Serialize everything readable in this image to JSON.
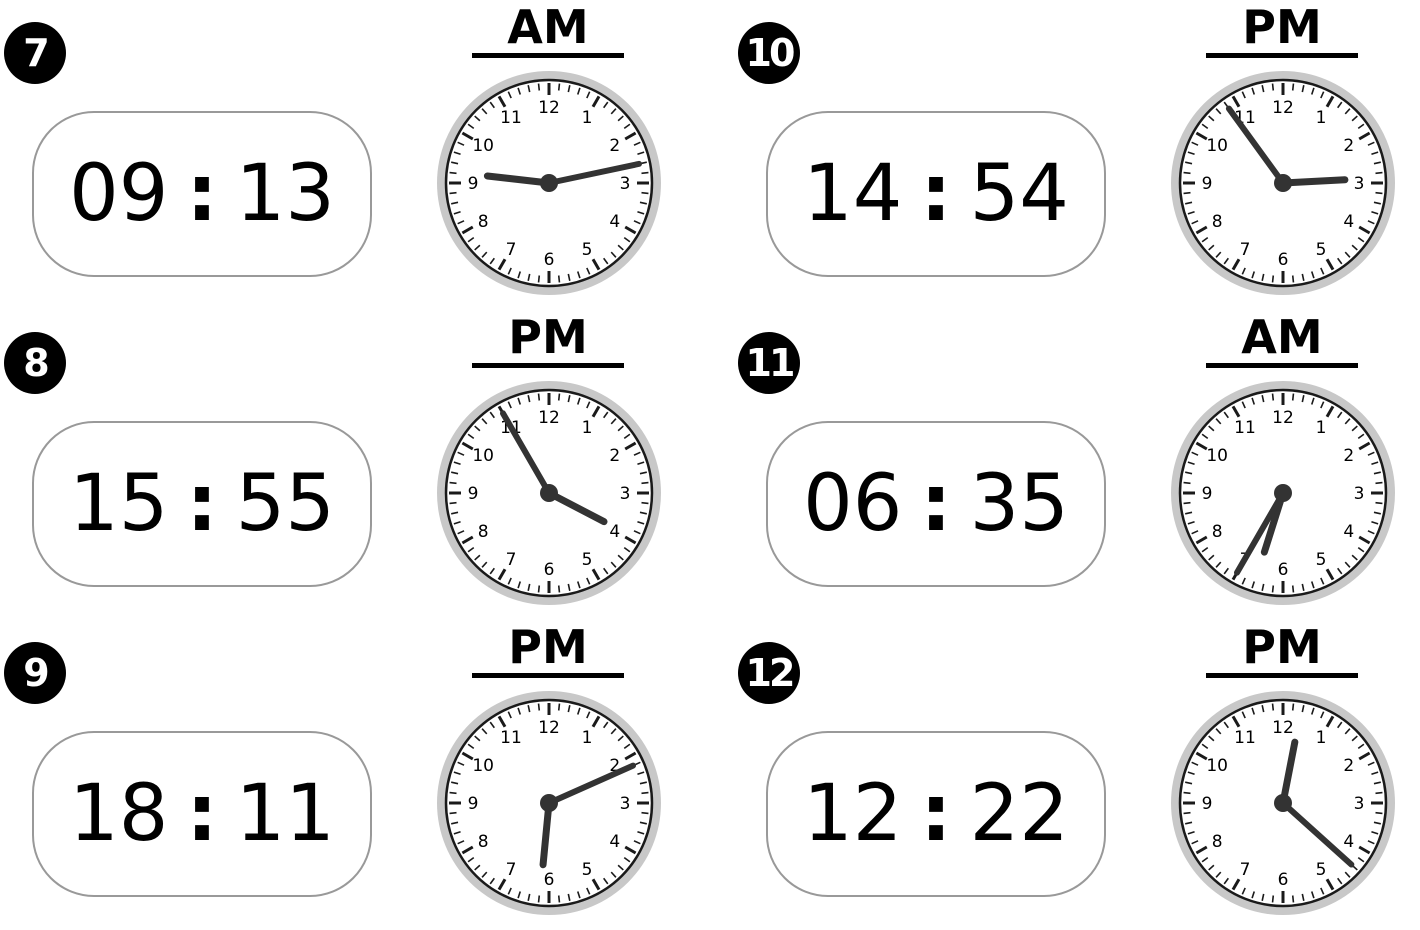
{
  "items": [
    {
      "number": "7",
      "digital_hours": "09",
      "digital_minutes": "13",
      "period": "AM",
      "clock_hour": 9,
      "clock_minute": 13
    },
    {
      "number": "8",
      "digital_hours": "15",
      "digital_minutes": "55",
      "period": "PM",
      "clock_hour": 3,
      "clock_minute": 55
    },
    {
      "number": "9",
      "digital_hours": "18",
      "digital_minutes": "11",
      "period": "PM",
      "clock_hour": 6,
      "clock_minute": 11
    },
    {
      "number": "10",
      "digital_hours": "14",
      "digital_minutes": "54",
      "period": "PM",
      "clock_hour": 2,
      "clock_minute": 54
    },
    {
      "number": "11",
      "digital_hours": "06",
      "digital_minutes": "35",
      "period": "AM",
      "clock_hour": 6,
      "clock_minute": 35
    },
    {
      "number": "12",
      "digital_hours": "12",
      "digital_minutes": "22",
      "period": "PM",
      "clock_hour": 12,
      "clock_minute": 22
    }
  ],
  "colon": ":",
  "clock_numerals": [
    "12",
    "1",
    "2",
    "3",
    "4",
    "5",
    "6",
    "7",
    "8",
    "9",
    "10",
    "11"
  ]
}
